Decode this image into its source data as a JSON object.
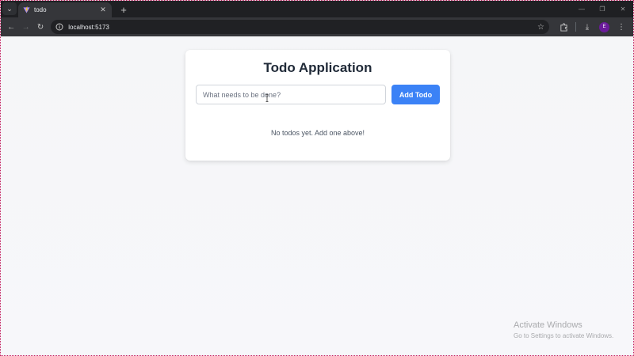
{
  "browser": {
    "tab": {
      "title": "todo",
      "close_glyph": "✕",
      "favicon": "vite-icon"
    },
    "new_tab_glyph": "+",
    "tab_menu_glyph": "⌄",
    "window_controls": {
      "minimize": "—",
      "restore": "❐",
      "close": "✕"
    },
    "nav": {
      "back": "←",
      "forward": "→",
      "reload": "↻"
    },
    "url": "localhost:5173",
    "icons": {
      "star": "☆",
      "extensions": "⬚",
      "download": "⤓",
      "menu": "⋮"
    },
    "avatar_initial": "E"
  },
  "app": {
    "title": "Todo Application",
    "input": {
      "value": "",
      "placeholder": "What needs to be done?"
    },
    "add_button_label": "Add Todo",
    "empty_message": "No todos yet. Add one above!",
    "colors": {
      "primary": "#3b82f6",
      "title": "#1f2937"
    }
  },
  "watermark": {
    "title": "Activate Windows",
    "subtitle": "Go to Settings to activate Windows."
  }
}
